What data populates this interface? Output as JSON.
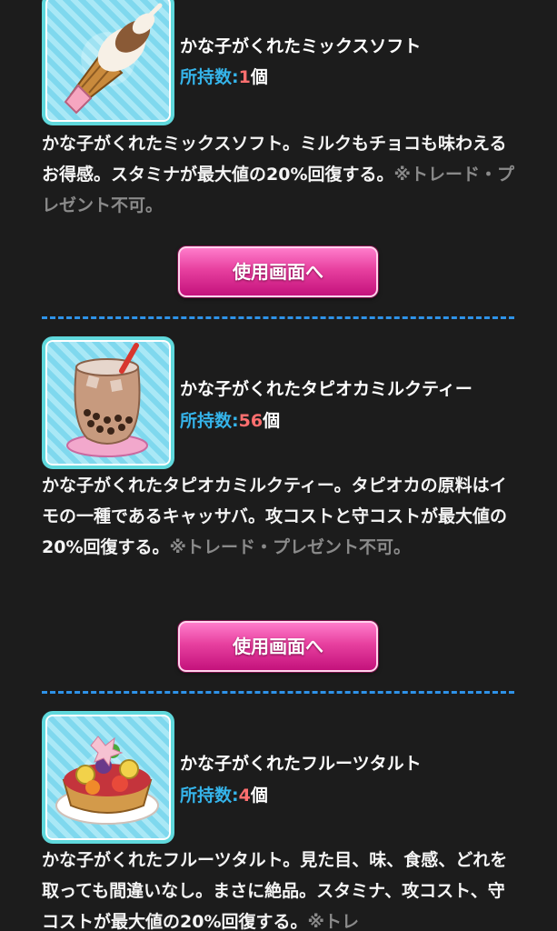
{
  "items": [
    {
      "name": "かな子がくれたミックスソフト",
      "count_label": "所持数:",
      "count_value": "1",
      "count_unit": "個",
      "description": "かな子がくれたミックスソフト。ミルクもチョコも味わえるお得感。スタミナが最大値の20%回復する。",
      "note": "※トレード・プレゼント不可。",
      "button_label": "使用画面へ",
      "icon": "mix-soft-serve-icon"
    },
    {
      "name": "かな子がくれたタピオカミルクティー",
      "count_label": "所持数:",
      "count_value": "56",
      "count_unit": "個",
      "description": "かな子がくれたタピオカミルクティー。タピオカの原料はイモの一種であるキャッサバ。攻コストと守コストが最大値の20%回復する。",
      "note": "※トレード・プレゼント不可。",
      "button_label": "使用画面へ",
      "icon": "tapioca-milk-tea-icon"
    },
    {
      "name": "かな子がくれたフルーツタルト",
      "count_label": "所持数:",
      "count_value": "4",
      "count_unit": "個",
      "description": "かな子がくれたフルーツタルト。見た目、味、食感、どれを取っても間違いなし。まさに絶品。スタミナ、攻コスト、守コストが最大値の20%回復する。",
      "note": "※トレ",
      "icon": "fruit-tart-icon"
    }
  ],
  "colors": {
    "background": "#1c1c1c",
    "count_label": "#35b4ea",
    "count_value": "#ff6f6f",
    "note": "#8a8a8a",
    "button": "#e7409f",
    "divider": "#2e92e8"
  }
}
